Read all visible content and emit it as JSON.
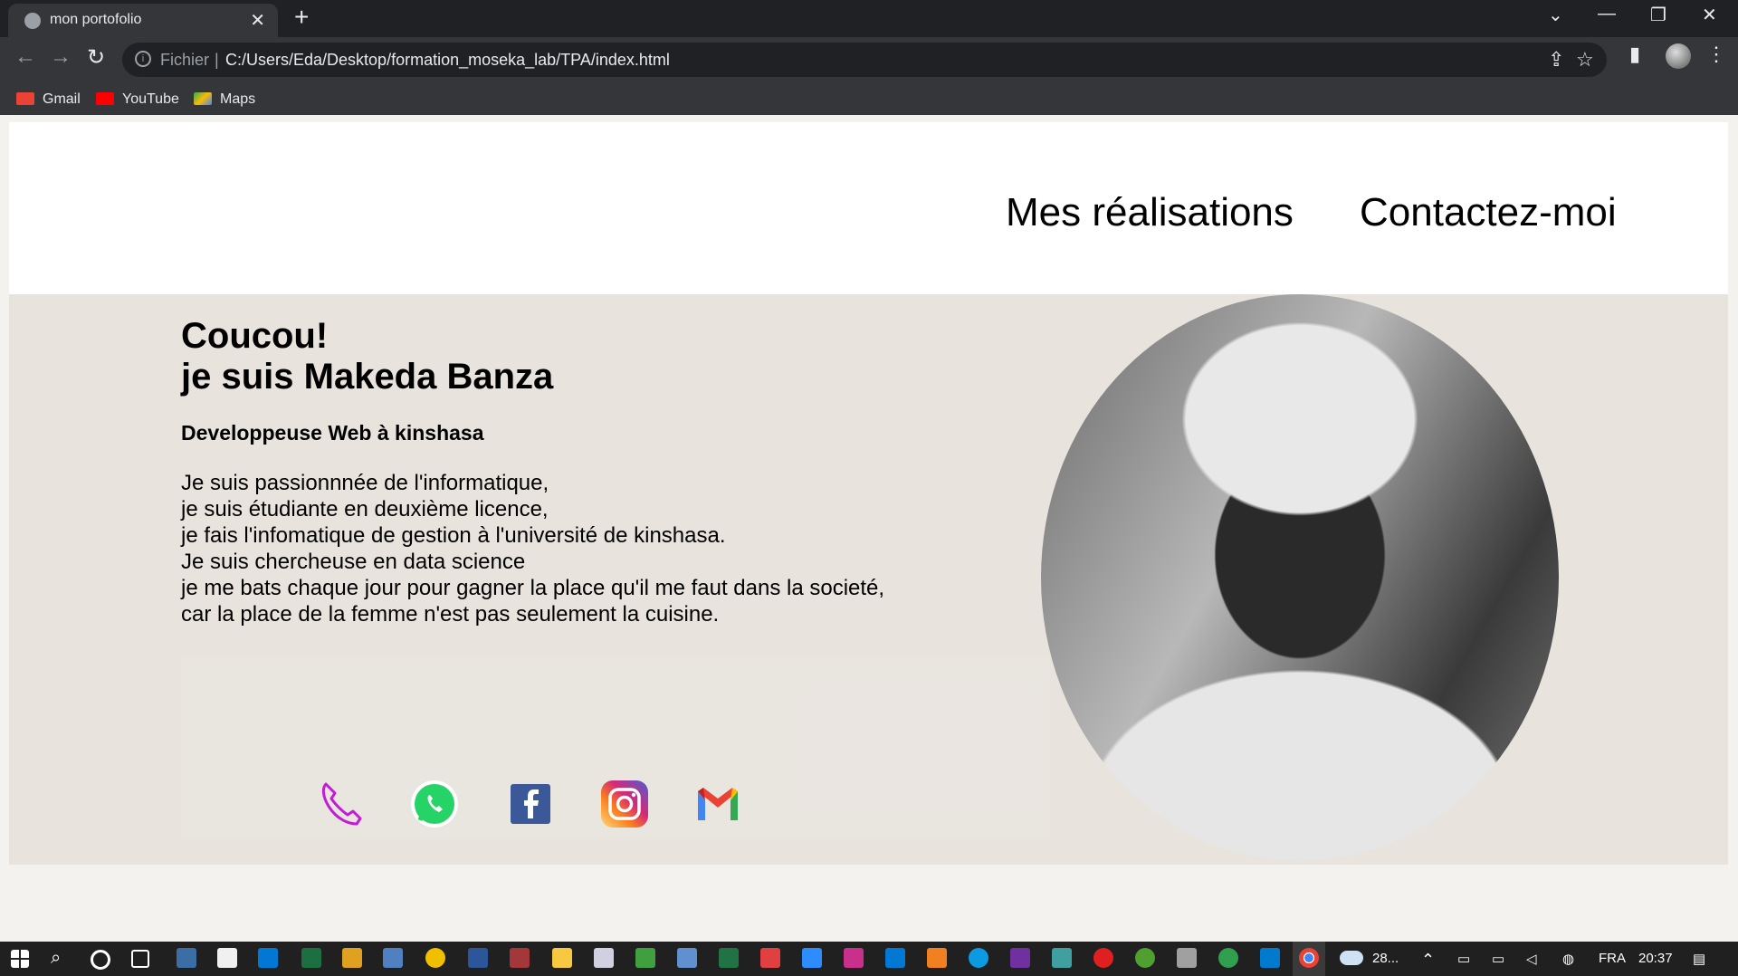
{
  "browser": {
    "tab_title": "mon portofolio",
    "address_scheme": "Fichier",
    "address_url": "C:/Users/Eda/Desktop/formation_moseka_lab/TPA/index.html",
    "bookmarks": [
      {
        "label": "Gmail",
        "icon": "gmail-icon"
      },
      {
        "label": "YouTube",
        "icon": "youtube-icon"
      },
      {
        "label": "Maps",
        "icon": "maps-icon"
      }
    ]
  },
  "page": {
    "nav": [
      "Mes réalisations",
      "Contactez-moi"
    ],
    "greeting": "Coucou!",
    "name_line": "je suis Makeda Banza",
    "subtitle": "Developpeuse Web à kinshasa",
    "paragraph": [
      "Je suis passionnnée de l'informatique,",
      "je suis étudiante en deuxième licence,",
      "je fais l'infomatique de gestion à l'université de kinshasa.",
      "Je suis chercheuse en data science",
      "je me bats chaque jour pour gagner la place qu'il me faut dans la societé,",
      "car la place de la femme n'est pas seulement la cuisine."
    ],
    "socials": [
      "phone-icon",
      "whatsapp-icon",
      "facebook-icon",
      "instagram-icon",
      "gmail-icon"
    ],
    "colors": {
      "hero_bg": "#e8e3dd",
      "header_bg": "#ffffff"
    }
  },
  "taskbar": {
    "weather": "28...",
    "language": "FRA",
    "time": "20:37"
  }
}
